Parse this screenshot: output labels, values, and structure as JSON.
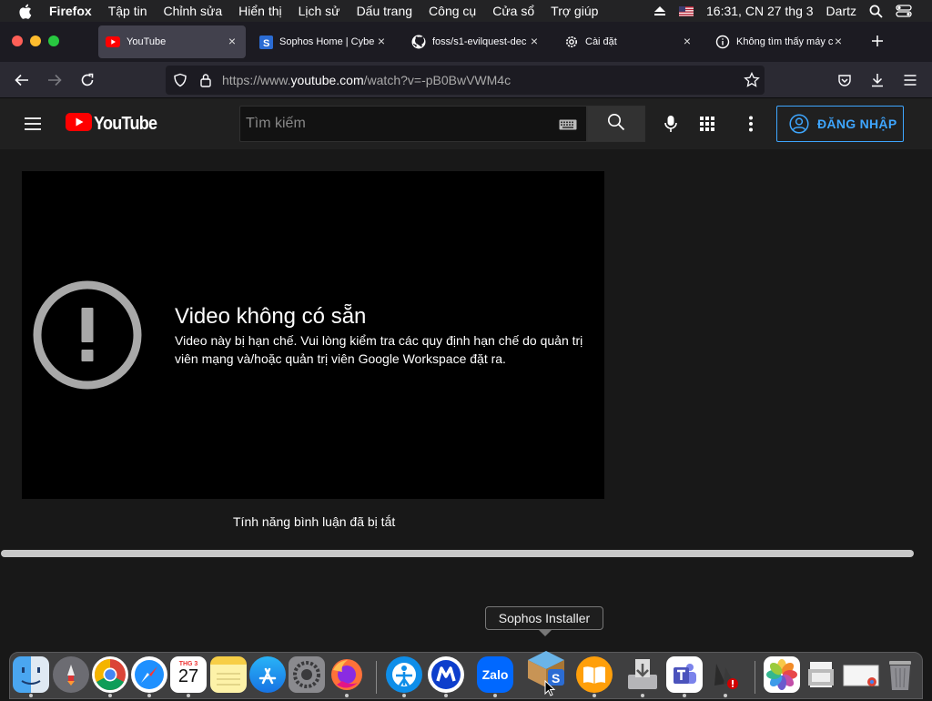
{
  "menubar": {
    "app_name": "Firefox",
    "items": [
      "Tập tin",
      "Chỉnh sửa",
      "Hiển thị",
      "Lịch sử",
      "Dấu trang",
      "Công cụ",
      "Cửa sổ",
      "Trợ giúp"
    ],
    "clock": "16:31, CN 27 thg 3",
    "user": "Dartz",
    "icons": [
      "apple-icon",
      "eject-icon",
      "us-flag-icon",
      "spotlight-search-icon",
      "control-center-icon"
    ]
  },
  "tabs": [
    {
      "label": "YouTube",
      "icon": "youtube-icon",
      "active": true
    },
    {
      "label": "Sophos Home | Cybe",
      "icon": "sophos-icon",
      "active": false
    },
    {
      "label": "foss/s1-evilquest-dec",
      "icon": "github-icon",
      "active": false
    },
    {
      "label": "Cài đặt",
      "icon": "gear-icon",
      "active": false
    },
    {
      "label": "Không tìm thấy máy c",
      "icon": "info-icon",
      "active": false
    }
  ],
  "navbar": {
    "url_prefix": "https://www.",
    "url_domain": "youtube.com",
    "url_suffix": "/watch?v=-pB0BwVWM4c"
  },
  "youtube": {
    "logo_text": "YouTube",
    "search_placeholder": "Tìm kiếm",
    "signin_label": "ĐĂNG NHẬP",
    "error_title": "Video không có sẵn",
    "error_message": "Video này bị hạn chế. Vui lòng kiểm tra các quy định hạn chế do quản trị viên mạng và/hoặc quản trị viên Google Workspace đặt ra.",
    "comments_disabled": "Tính năng bình luận đã bị tắt"
  },
  "dock": {
    "tooltip": "Sophos Installer",
    "calendar_month": "THG 3",
    "calendar_day": "27",
    "zalo_label": "Zalo",
    "apps": [
      "finder-icon",
      "launchpad-icon",
      "chrome-icon",
      "safari-icon",
      "calendar-icon",
      "notes-icon",
      "app-store-icon",
      "system-preferences-icon",
      "firefox-icon",
      "teamviewer-icon",
      "malwarebytes-icon",
      "zalo-icon",
      "sophos-installer-icon",
      "books-icon",
      "installer-icon",
      "teams-icon",
      "directory-utility-icon",
      "photos-icon",
      "preview-icon",
      "chrome-file-icon",
      "trash-icon"
    ]
  },
  "colors": {
    "youtube_red": "#ff0000",
    "signin_blue": "#3ea6ff",
    "page_bg": "#181818",
    "header_bg": "#202020"
  }
}
